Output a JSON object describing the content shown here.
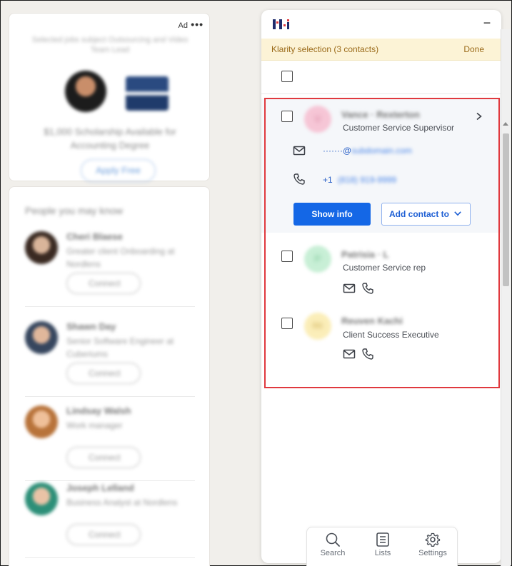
{
  "background": {
    "ad": {
      "label": "Ad",
      "more": "•••",
      "tagline": "Selected jobs subject Outsourcing and Video Team Lead",
      "headline": "$1,000 Scholarship Available for Accounting Degree",
      "button": "Apply Free"
    },
    "people": {
      "title": "People you may know",
      "connect_label": "Connect",
      "items": [
        {
          "name": "Cheri Blaese",
          "subtitle": "Greater client Onboarding at Nordlens"
        },
        {
          "name": "Shawn Day",
          "subtitle": "Senior Software Engineer at Cuberiums"
        },
        {
          "name": "Lindsay Walsh",
          "subtitle": "Work manager"
        },
        {
          "name": "Joseph Lelland",
          "subtitle": "Business Analyst at Nordlens"
        }
      ]
    }
  },
  "panel": {
    "selection_text": "Klarity selection (3 contacts)",
    "done_label": "Done",
    "minimize": "−",
    "contacts": [
      {
        "initial": "V",
        "name": "Vance · Rexterton",
        "title": "Customer Service Supervisor",
        "email_mask": "·······@",
        "email_domain": "subdomain.com",
        "phone_prefix": "+1",
        "phone_rest": "(818) 919-9999",
        "show_info_label": "Show info",
        "add_contact_label": "Add contact to"
      },
      {
        "initial": "P",
        "name": "Patrisia · L",
        "title": "Customer Service rep"
      },
      {
        "initial": "RK",
        "name": "Reuven Kachi",
        "title": "Client Success Executive"
      }
    ]
  },
  "nav": {
    "search": "Search",
    "lists": "Lists",
    "settings": "Settings"
  },
  "colors": {
    "accent": "#1467e6",
    "highlight": "#e0393e",
    "banner_bg": "#fcf3d6",
    "banner_text": "#9b6b1a"
  }
}
